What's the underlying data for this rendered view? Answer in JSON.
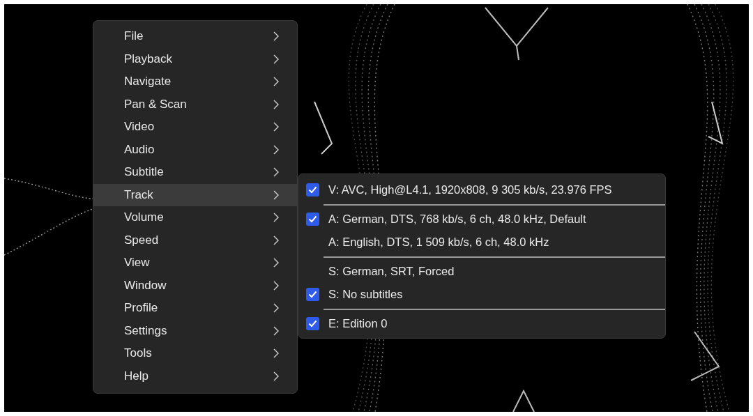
{
  "menu": {
    "items": [
      {
        "label": "File",
        "selected": false
      },
      {
        "label": "Playback",
        "selected": false
      },
      {
        "label": "Navigate",
        "selected": false
      },
      {
        "label": "Pan & Scan",
        "selected": false
      },
      {
        "label": "Video",
        "selected": false
      },
      {
        "label": "Audio",
        "selected": false
      },
      {
        "label": "Subtitle",
        "selected": false
      },
      {
        "label": "Track",
        "selected": true
      },
      {
        "label": "Volume",
        "selected": false
      },
      {
        "label": "Speed",
        "selected": false
      },
      {
        "label": "View",
        "selected": false
      },
      {
        "label": "Window",
        "selected": false
      },
      {
        "label": "Profile",
        "selected": false
      },
      {
        "label": "Settings",
        "selected": false
      },
      {
        "label": "Tools",
        "selected": false
      },
      {
        "label": "Help",
        "selected": false
      }
    ]
  },
  "submenu": {
    "groups": [
      {
        "items": [
          {
            "label": "V: AVC, High@L4.1, 1920x808, 9 305 kb/s, 23.976 FPS",
            "checked": true
          }
        ]
      },
      {
        "items": [
          {
            "label": "A: German, DTS, 768 kb/s, 6 ch, 48.0 kHz, Default",
            "checked": true
          },
          {
            "label": "A: English, DTS, 1 509 kb/s, 6 ch, 48.0 kHz",
            "checked": false
          }
        ]
      },
      {
        "items": [
          {
            "label": "S: German, SRT, Forced",
            "checked": false
          },
          {
            "label": "S: No subtitles",
            "checked": true
          }
        ]
      },
      {
        "items": [
          {
            "label": "E: Edition 0",
            "checked": true
          }
        ]
      }
    ]
  }
}
